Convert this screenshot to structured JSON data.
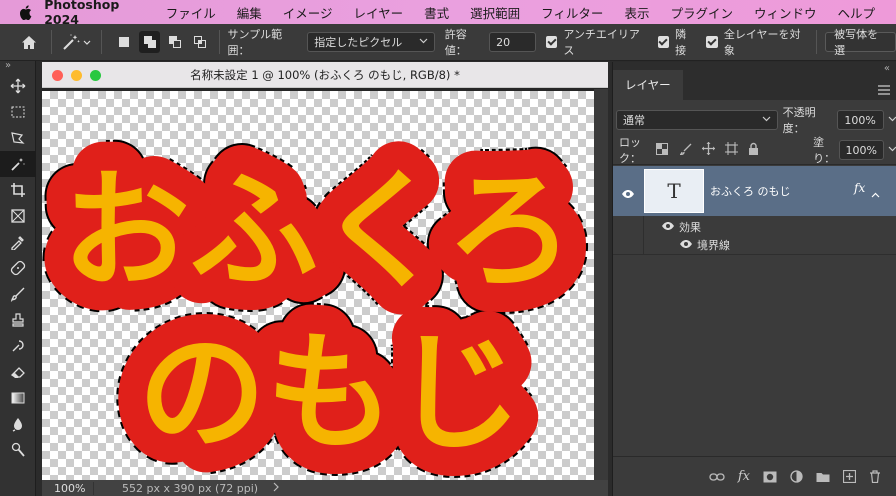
{
  "menubar": {
    "app_name": "Photoshop 2024",
    "items": [
      "ファイル",
      "編集",
      "イメージ",
      "レイヤー",
      "書式",
      "選択範囲",
      "フィルター",
      "表示",
      "プラグイン",
      "ウィンドウ",
      "ヘルプ"
    ]
  },
  "options": {
    "sample_label": "サンプル範囲：",
    "sample_value": "指定したピクセル",
    "tolerance_label": "許容値：",
    "tolerance_value": "20",
    "antialias_label": "アンチエイリアス",
    "contiguous_label": "隣接",
    "all_layers_label": "全レイヤーを対象",
    "subject_button": "被写体を選"
  },
  "document": {
    "title": "名称未設定 1 @ 100% (おふくろ のもじ, RGB/8) *",
    "zoom": "100%",
    "info": "552 px x 390 px (72 ppi)",
    "line1": "おふくろ",
    "line2": "のもじ",
    "text_color": "#f6b400",
    "stroke_color": "#e0201a"
  },
  "layers_panel": {
    "tab": "レイヤー",
    "blend_mode": "通常",
    "opacity_label": "不透明度：",
    "opacity_value": "100%",
    "lock_label": "ロック：",
    "fill_label": "塗り：",
    "fill_value": "100%",
    "layer_name": "おふくろ のもじ",
    "layer_thumb": "T",
    "fx": "fx",
    "effects_label": "効果",
    "stroke_label": "境界線"
  },
  "colors": {
    "menubar": "#e99edc",
    "selected_layer": "#5a6e87"
  }
}
